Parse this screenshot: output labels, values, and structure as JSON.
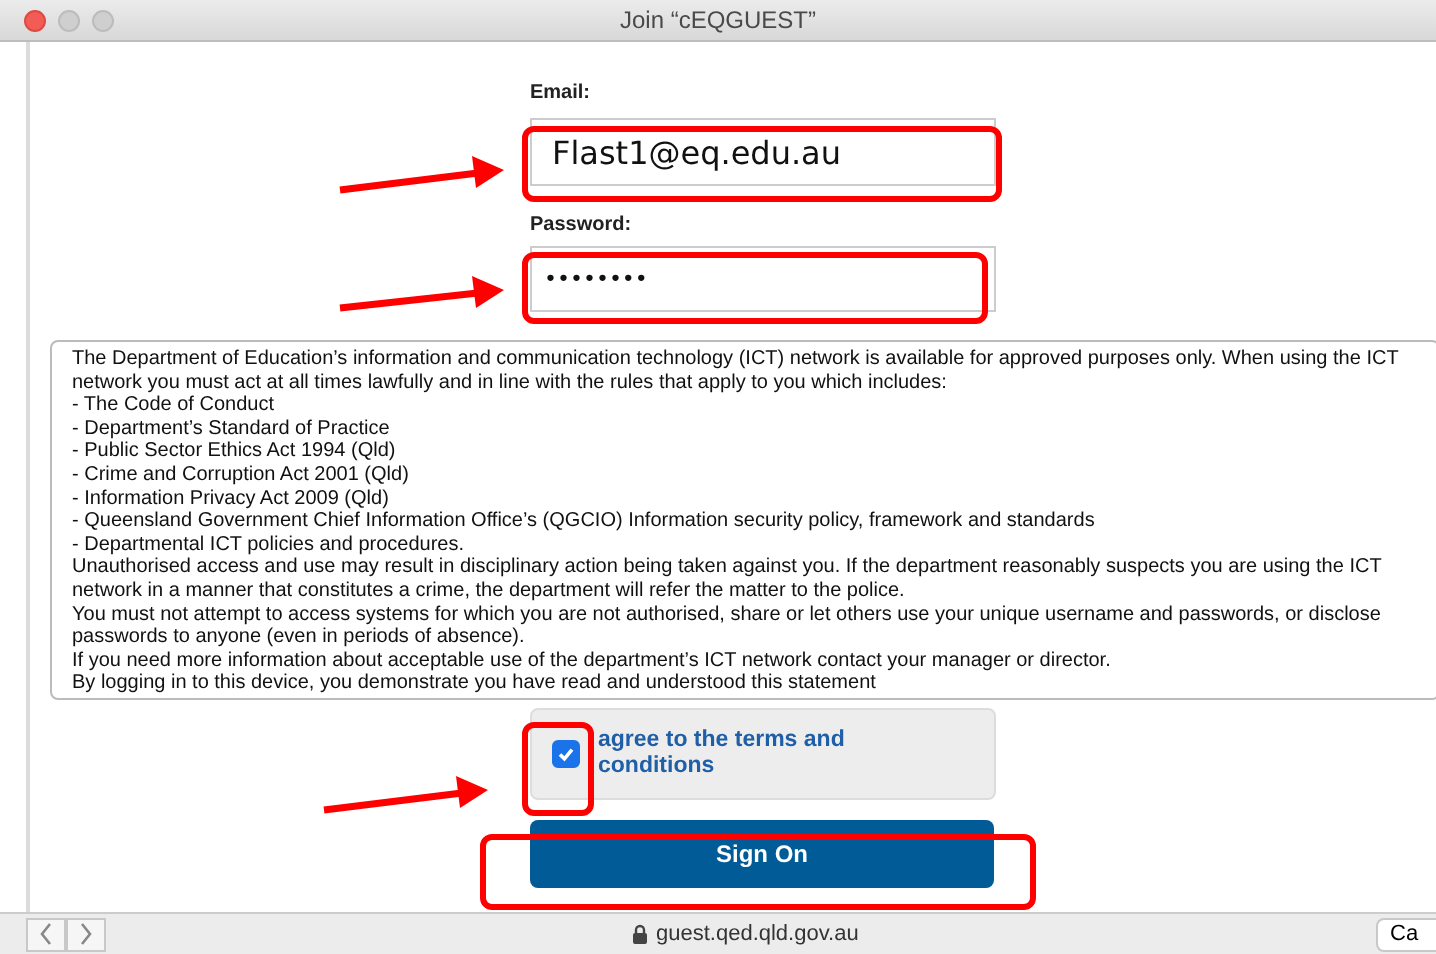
{
  "window": {
    "title": "Join “cEQGUEST”"
  },
  "form": {
    "email": {
      "label": "Email:",
      "value": "Flast1@eq.edu.au"
    },
    "password": {
      "label": "Password:",
      "value": "••••••••"
    },
    "terms_lines": [
      "The Department of Education’s information and communication technology (ICT) network is available for approved purposes only. When using the ICT network you must act at all times lawfully and in line with the rules that apply to you which includes:",
      "- The Code of Conduct",
      "- Department’s Standard of Practice",
      "- Public Sector Ethics Act 1994 (Qld)",
      "- Crime and Corruption Act 2001 (Qld)",
      "- Information Privacy Act 2009 (Qld)",
      "- Queensland Government Chief Information Office’s (QGCIO) Information security policy, framework and standards",
      "- Departmental ICT policies and procedures.",
      "Unauthorised access and use may result in disciplinary action being taken against you. If the department reasonably suspects you are using the ICT network in a manner that constitutes a crime, the department will refer the matter to the police.",
      "You must not attempt to access systems for which you are not authorised, share or let others use your unique username and passwords, or disclose passwords to anyone (even in periods of absence).",
      "If you need more information about acceptable use of the department’s ICT network contact your manager or director.",
      "By logging in to this device, you demonstrate you have read and understood this statement"
    ],
    "agree": {
      "label": "agree to the terms and conditions",
      "checked": true
    },
    "submit": "Sign On"
  },
  "bottom_bar": {
    "url": "guest.qed.qld.gov.au",
    "button": "Ca"
  }
}
